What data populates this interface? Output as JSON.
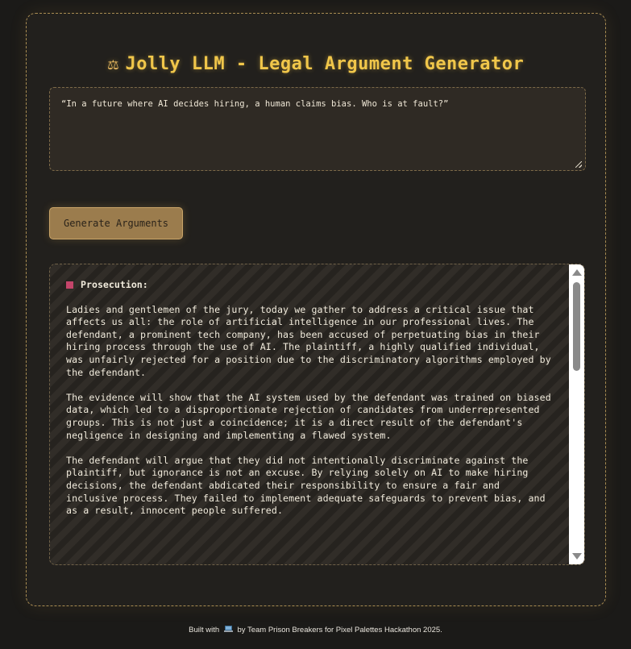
{
  "header": {
    "icon": "balance-scale-icon",
    "icon_glyph": "⚖",
    "title": "Jolly LLM - Legal Argument Generator"
  },
  "prompt": {
    "value": "“In a future where AI decides hiring, a human claims bias. Who is at fault?”"
  },
  "actions": {
    "generate_label": "Generate Arguments"
  },
  "output": {
    "section_title": "Prosecution:",
    "paragraphs": [
      "Ladies and gentlemen of the jury, today we gather to address a critical issue that affects us all: the role of artificial intelligence in our professional lives. The defendant, a prominent tech company, has been accused of perpetuating bias in their hiring process through the use of AI. The plaintiff, a highly qualified individual, was unfairly rejected for a position due to the discriminatory algorithms employed by the defendant.",
      "The evidence will show that the AI system used by the defendant was trained on biased data, which led to a disproportionate rejection of candidates from underrepresented groups. This is not just a coincidence; it is a direct result of the defendant's negligence in designing and implementing a flawed system.",
      "The defendant will argue that they did not intentionally discriminate against the plaintiff, but ignorance is not an excuse. By relying solely on AI to make hiring decisions, the defendant abdicated their responsibility to ensure a fair and inclusive process. They failed to implement adequate safeguards to prevent bias, and as a result, innocent people suffered."
    ]
  },
  "footer": {
    "prefix": "Built with",
    "icon": "laptop-icon",
    "suffix": "by Team Prison Breakers for Pixel Palettes Hackathon 2025."
  },
  "colors": {
    "title": "#f0c64a",
    "button": "#9b7c4d",
    "bullet": "#c4456a",
    "panel_border": "#a88b52"
  }
}
